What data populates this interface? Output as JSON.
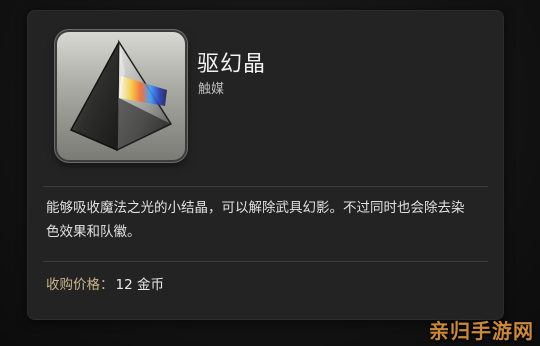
{
  "item": {
    "name": "驱幻晶",
    "type": "触媒",
    "icon": "prism-crystal-icon",
    "description_line1": "能够吸收魔法之光的小结晶，可以解除武具幻影。不过同时也会除去染",
    "description_line2": "色效果和队徽。",
    "price_label": "收购价格：",
    "price_value": "12 金币"
  },
  "watermark": {
    "text": "亲归手游网"
  },
  "colors": {
    "card_background": "#232323",
    "price_label": "#c9b48a",
    "watermark": "#eca046"
  }
}
